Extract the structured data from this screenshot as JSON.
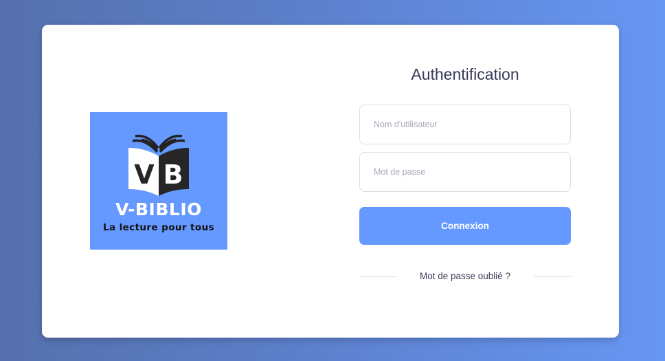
{
  "brand": {
    "logo_letters": "VB",
    "name": "V-BIBLIO",
    "tagline": "La lecture pour tous"
  },
  "login": {
    "title": "Authentification",
    "username_placeholder": "Nom d'utilisateur",
    "password_placeholder": "Mot de passe",
    "submit_label": "Connexion",
    "forgot_label": "Mot de passe oublié ?"
  },
  "colors": {
    "accent": "#6699ff",
    "title_text": "#393a57",
    "background_start": "#5570ac",
    "background_end": "#6696f3"
  },
  "icons": {
    "logo": "open-book-icon"
  }
}
